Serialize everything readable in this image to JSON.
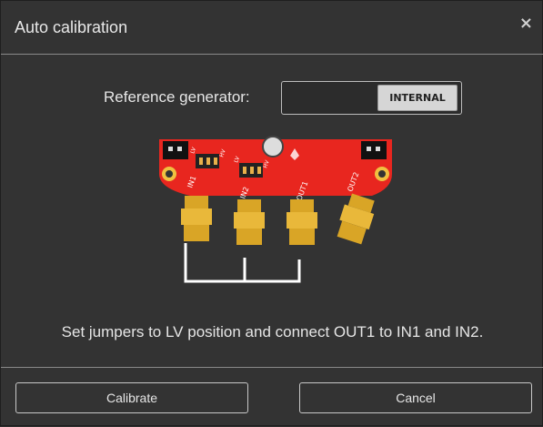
{
  "dialog": {
    "title": "Auto calibration",
    "close_glyph": "×"
  },
  "reference": {
    "label": "Reference generator:",
    "value": "INTERNAL"
  },
  "board": {
    "labels": [
      "IN1",
      "IN2",
      "OUT1",
      "OUT2",
      "LV",
      "HV",
      "LV",
      "HV"
    ]
  },
  "instruction": "Set jumpers to LV position and connect OUT1 to IN1 and IN2.",
  "buttons": {
    "calibrate": "Calibrate",
    "cancel": "Cancel"
  }
}
